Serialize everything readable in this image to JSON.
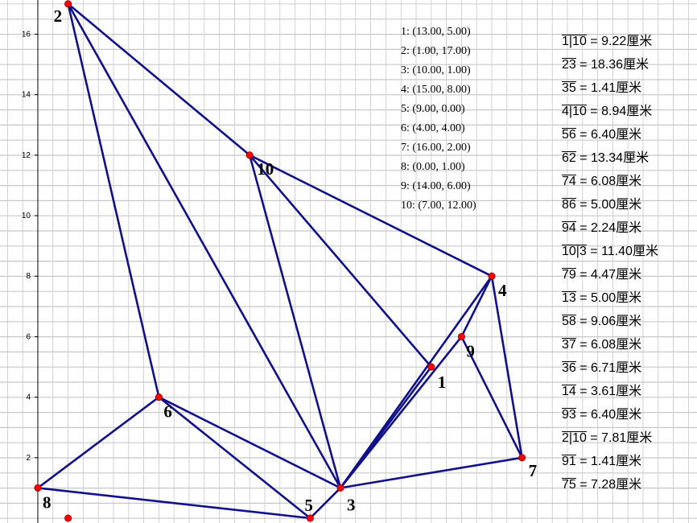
{
  "points": [
    {
      "label": "1",
      "x": 13,
      "y": 5
    },
    {
      "label": "2",
      "x": 1,
      "y": 17
    },
    {
      "label": "3",
      "x": 10,
      "y": 1
    },
    {
      "label": "4",
      "x": 15,
      "y": 8
    },
    {
      "label": "5",
      "x": 9,
      "y": 0
    },
    {
      "label": "6",
      "x": 4,
      "y": 4
    },
    {
      "label": "7",
      "x": 16,
      "y": 2
    },
    {
      "label": "8",
      "x": 0,
      "y": 1
    },
    {
      "label": "9",
      "x": 14,
      "y": 6
    },
    {
      "label": "10",
      "x": 7,
      "y": 12
    }
  ],
  "extra_point": {
    "x": 1,
    "y": 0
  },
  "edges": [
    [
      "2",
      "10"
    ],
    [
      "10",
      "4"
    ],
    [
      "2",
      "6"
    ],
    [
      "2",
      "3"
    ],
    [
      "10",
      "3"
    ],
    [
      "10",
      "1"
    ],
    [
      "1",
      "3"
    ],
    [
      "9",
      "3"
    ],
    [
      "4",
      "3"
    ],
    [
      "4",
      "9"
    ],
    [
      "4",
      "7"
    ],
    [
      "9",
      "7"
    ],
    [
      "3",
      "7"
    ],
    [
      "6",
      "3"
    ],
    [
      "6",
      "5"
    ],
    [
      "6",
      "8"
    ],
    [
      "8",
      "5"
    ],
    [
      "5",
      "3"
    ]
  ],
  "coord_lines": [
    "1: (13.00, 5.00)",
    "2: (1.00, 17.00)",
    "3: (10.00, 1.00)",
    "4: (15.00, 8.00)",
    "5: (9.00, 0.00)",
    "6: (4.00, 4.00)",
    "7: (16.00, 2.00)",
    "8: (0.00, 1.00)",
    "9: (14.00, 6.00)",
    "10: (7.00, 12.00)"
  ],
  "measurements": [
    {
      "seg": "1|10",
      "val": " = 9.22厘米"
    },
    {
      "seg": "23",
      "val": " = 18.36厘米"
    },
    {
      "seg": "35",
      "val": " = 1.41厘米"
    },
    {
      "seg": "4|10",
      "val": " = 8.94厘米"
    },
    {
      "seg": "56",
      "val": " = 6.40厘米"
    },
    {
      "seg": "62",
      "val": " = 13.34厘米"
    },
    {
      "seg": "74",
      "val": " = 6.08厘米"
    },
    {
      "seg": "86",
      "val": " = 5.00厘米"
    },
    {
      "seg": "94",
      "val": " = 2.24厘米"
    },
    {
      "seg": "10|3",
      "val": " = 11.40厘米"
    },
    {
      "seg": "79",
      "val": " = 4.47厘米"
    },
    {
      "seg": "13",
      "val": " = 5.00厘米"
    },
    {
      "seg": "58",
      "val": " = 9.06厘米"
    },
    {
      "seg": "37",
      "val": " = 6.08厘米"
    },
    {
      "seg": "36",
      "val": " = 6.71厘米"
    },
    {
      "seg": "14",
      "val": " = 3.61厘米"
    },
    {
      "seg": "93",
      "val": " = 6.40厘米"
    },
    {
      "seg": "2|10",
      "val": " = 7.81厘米"
    },
    {
      "seg": "91",
      "val": " = 1.41厘米"
    },
    {
      "seg": "75",
      "val": " = 7.28厘米"
    }
  ],
  "axis": {
    "y_ticks": [
      "2",
      "4",
      "6",
      "8",
      "10",
      "12",
      "14",
      "16"
    ]
  },
  "colors": {
    "grid": "#c8c8c8",
    "axis": "#000000",
    "edge": "#10108a",
    "point": "#ff0000"
  }
}
